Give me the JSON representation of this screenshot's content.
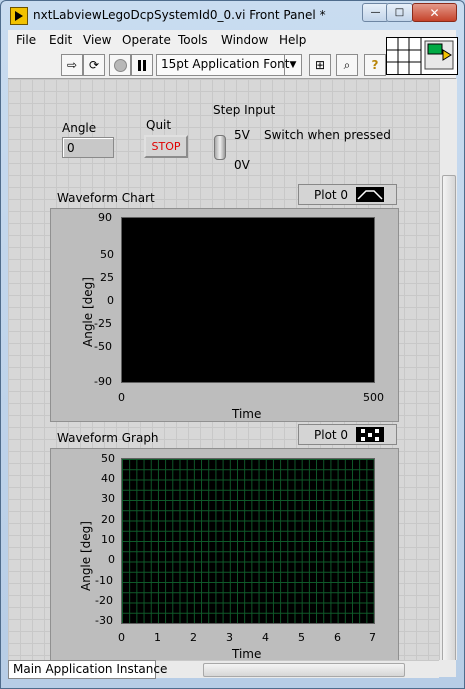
{
  "window": {
    "title": "nxtLabviewLegoDcpSystemId0_0.vi Front Panel *",
    "buttons": {
      "minimize": "—",
      "maximize": "□",
      "close": "✕"
    }
  },
  "menu": [
    "File",
    "Edit",
    "View",
    "Operate",
    "Tools",
    "Window",
    "Help"
  ],
  "toolbar": {
    "font": "15pt Application Font"
  },
  "controls": {
    "angle": {
      "label": "Angle",
      "value": "0"
    },
    "quit": {
      "label": "Quit",
      "button_text": "STOP"
    },
    "step": {
      "label": "Step Input",
      "on": "5V",
      "off": "0V",
      "mechanical": "Switch when pressed"
    }
  },
  "waveform_chart": {
    "title": "Waveform Chart",
    "legend": "Plot 0",
    "ylabel": "Angle [deg]",
    "xlabel": "Time",
    "y_ticks": [
      "90",
      "50",
      "25",
      "0",
      "-25",
      "-50",
      "-90"
    ],
    "x_ticks": [
      "0",
      "500"
    ]
  },
  "waveform_graph": {
    "title": "Waveform Graph",
    "legend": "Plot 0",
    "ylabel": "Angle [deg]",
    "xlabel": "Time",
    "y_ticks": [
      "50",
      "40",
      "30",
      "20",
      "10",
      "0",
      "-10",
      "-20",
      "-30"
    ],
    "x_ticks": [
      "0",
      "1",
      "2",
      "3",
      "4",
      "5",
      "6",
      "7"
    ]
  },
  "status": {
    "instance": "Main Application Instance"
  },
  "chart_data": [
    {
      "type": "line",
      "title": "Waveform Chart",
      "xlabel": "Time",
      "ylabel": "Angle [deg]",
      "xlim": [
        0,
        500
      ],
      "ylim": [
        -90,
        90
      ],
      "grid": false,
      "series": []
    },
    {
      "type": "line",
      "title": "Waveform Graph",
      "xlabel": "Time",
      "ylabel": "Angle [deg]",
      "xlim": [
        0,
        7
      ],
      "ylim": [
        -30,
        50
      ],
      "grid": true,
      "series": []
    }
  ],
  "colors": {
    "plot_bg": "#000000",
    "grid": "#0f5a2a",
    "stop_text": "#e00000"
  }
}
